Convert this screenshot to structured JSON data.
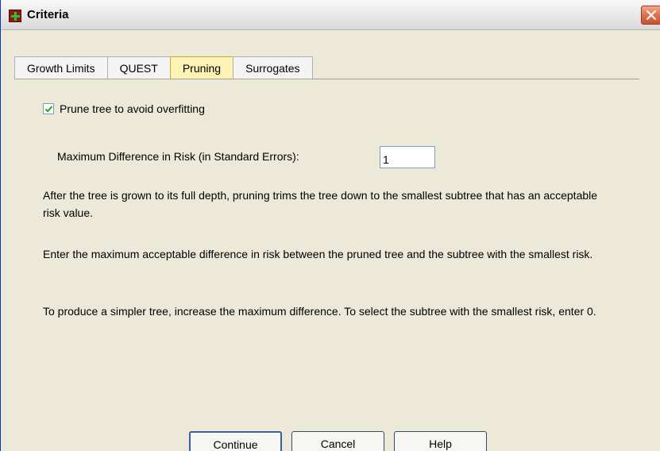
{
  "window": {
    "title": "Criteria",
    "icon": "spss-app-icon",
    "close_icon": "close-icon"
  },
  "tabs": [
    {
      "label": "Growth Limits",
      "active": false
    },
    {
      "label": "QUEST",
      "active": false
    },
    {
      "label": "Pruning",
      "active": true
    },
    {
      "label": "Surrogates",
      "active": false
    }
  ],
  "pruning": {
    "checkbox_label": "Prune tree to avoid overfitting",
    "checkbox_checked": true,
    "max_diff_label": "Maximum Difference in Risk (in Standard Errors):",
    "max_diff_value": "1",
    "paragraphs": [
      "After the tree is grown to its full depth, pruning trims the tree down to the smallest subtree that has an acceptable risk value.",
      "Enter the maximum acceptable difference in risk between the pruned tree and the subtree with the smallest risk.",
      "To produce a simpler tree, increase the maximum difference. To select the subtree with the smallest risk, enter 0."
    ]
  },
  "buttons": {
    "continue": "Continue",
    "cancel": "Cancel",
    "help": "Help"
  },
  "colors": {
    "active_tab": "#fff3b4",
    "dialog_bg": "#ece9d8",
    "close_button": "#e0704e"
  }
}
